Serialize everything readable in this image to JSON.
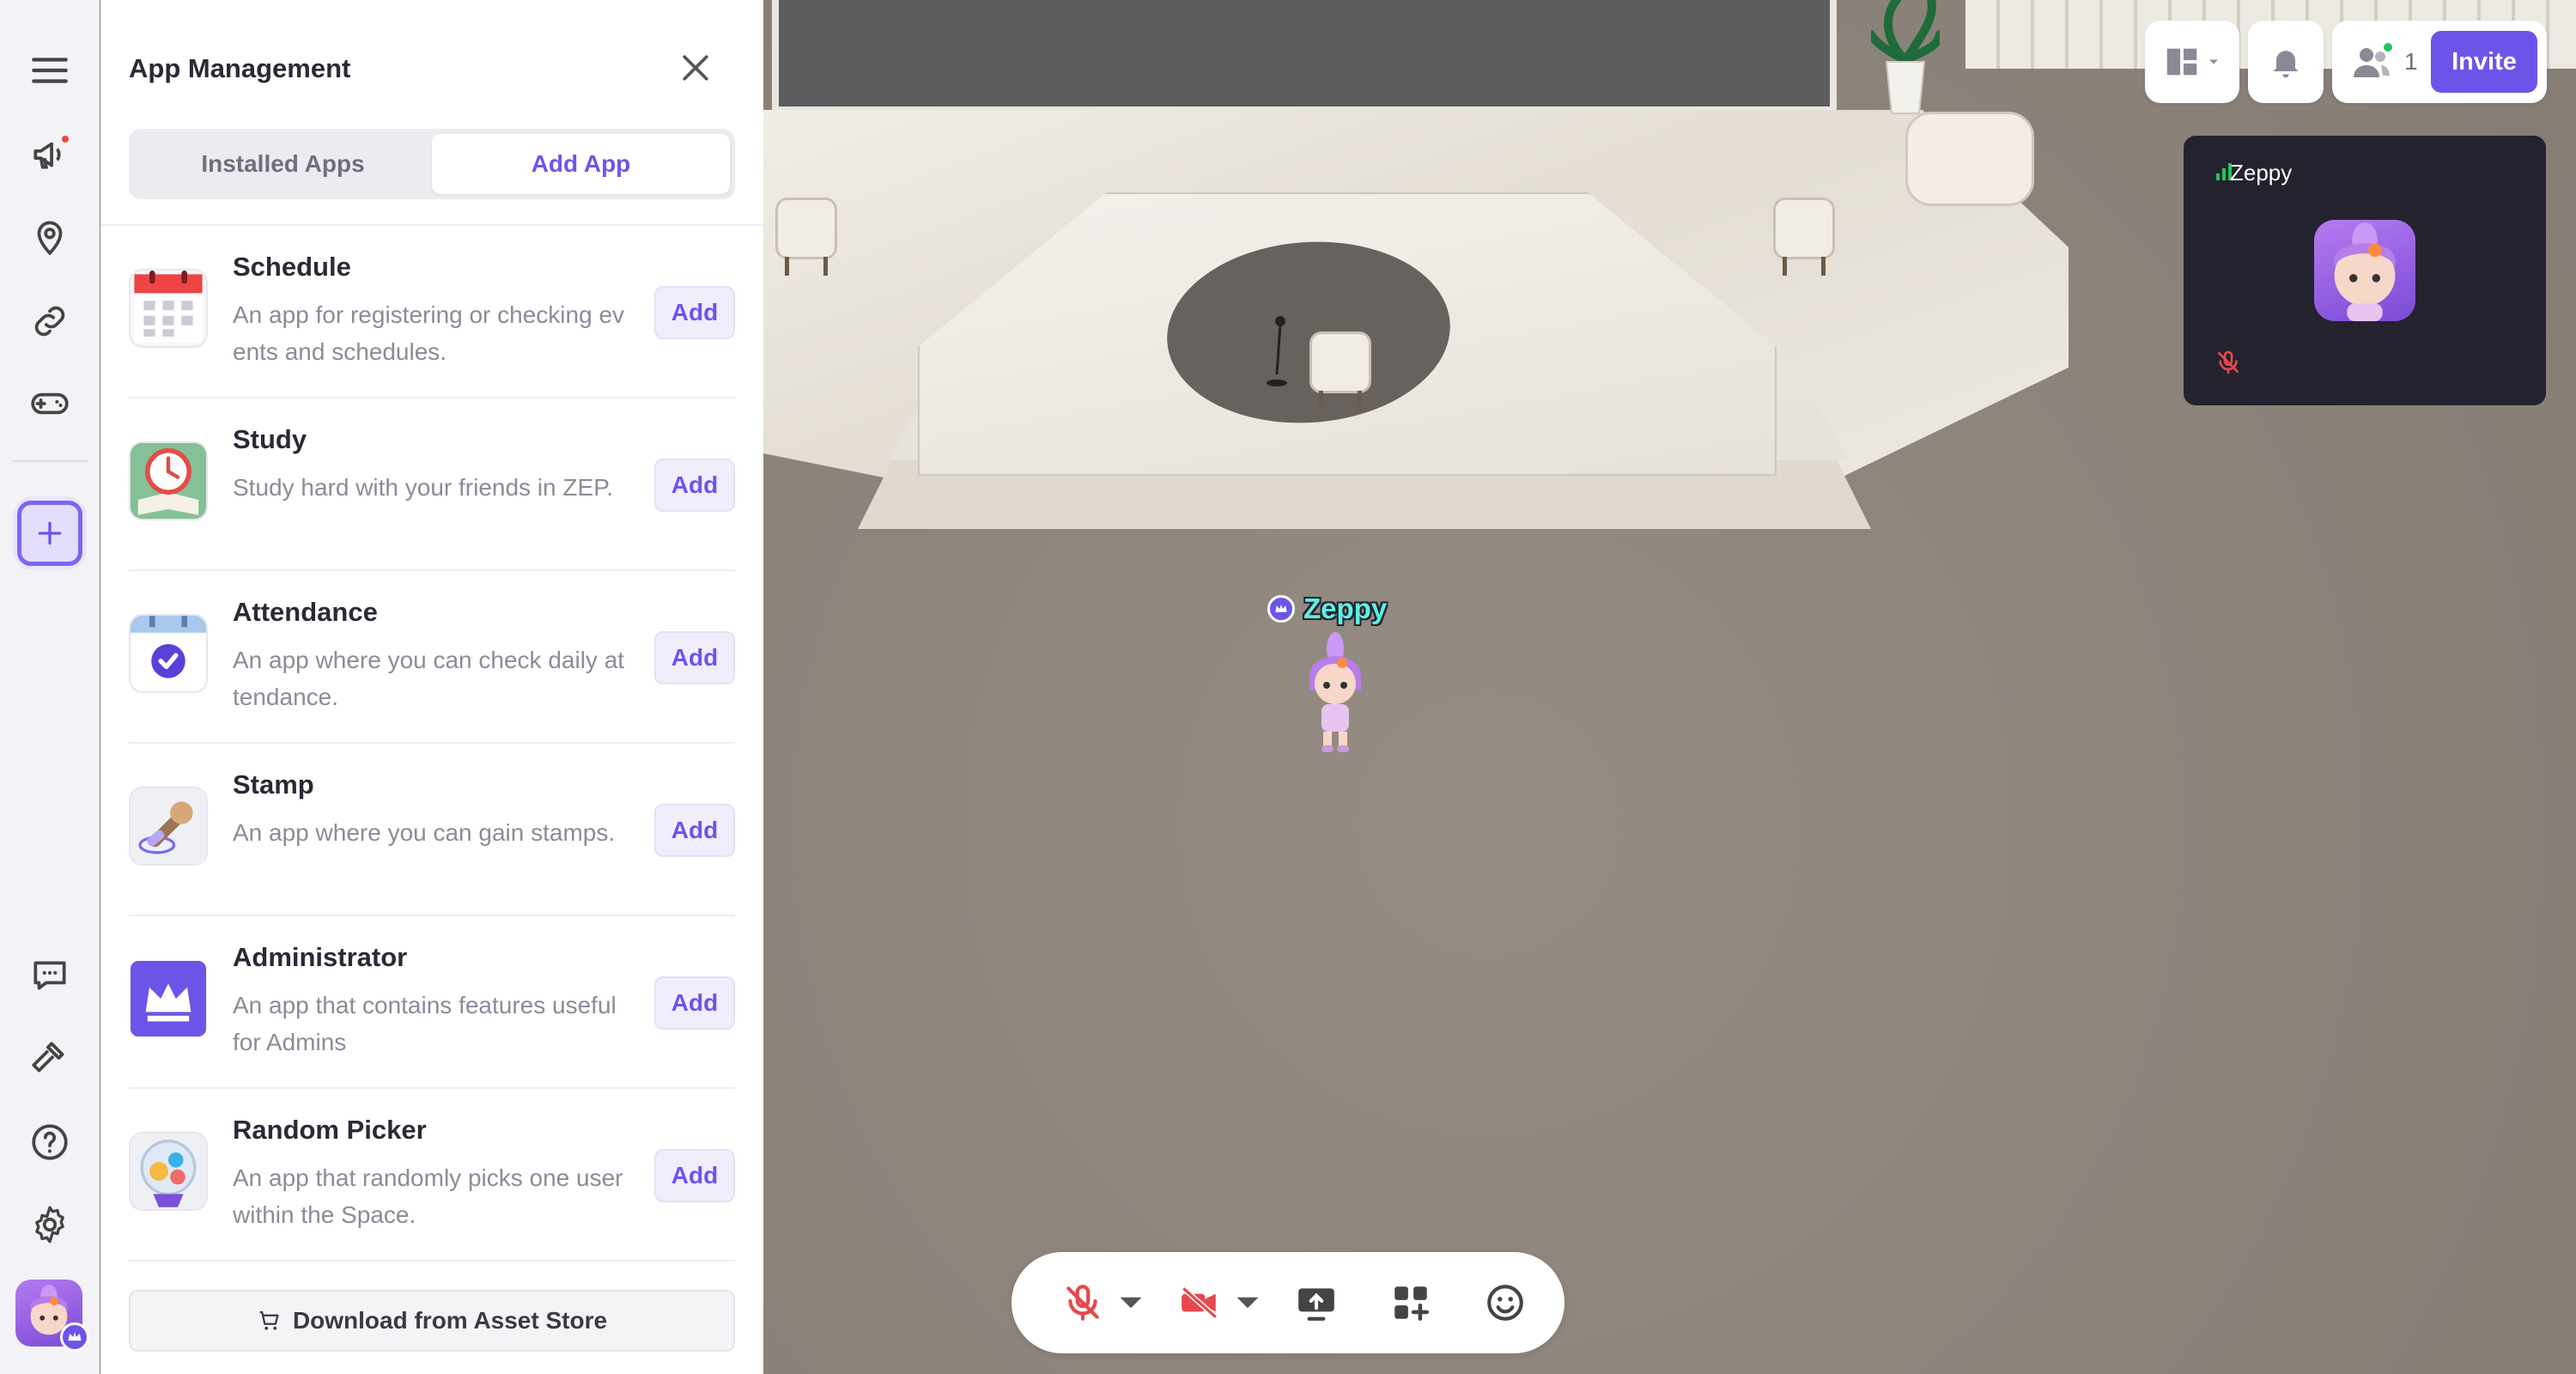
{
  "panel": {
    "title": "App Management",
    "tabs": [
      {
        "label": "Installed Apps",
        "active": false
      },
      {
        "label": "Add App",
        "active": true
      }
    ],
    "add_label": "Add",
    "apps": [
      {
        "name": "Schedule",
        "description": "An app for registering or checking events and schedules.",
        "icon": "calendar-icon"
      },
      {
        "name": "Study",
        "description": "Study hard with your friends in ZEP.",
        "icon": "study-clock-icon"
      },
      {
        "name": "Attendance",
        "description": "An app where you can check daily attendance.",
        "icon": "attendance-check-icon"
      },
      {
        "name": "Stamp",
        "description": "An app where you can gain stamps.",
        "icon": "stamp-icon"
      },
      {
        "name": "Administrator",
        "description": "An app that contains features useful for Admins",
        "icon": "crown-icon"
      },
      {
        "name": "Random Picker",
        "description": "An app that randomly picks one user within the Space.",
        "icon": "gacha-icon"
      }
    ],
    "store_label": "Download from Asset Store"
  },
  "header": {
    "participant_count": "1",
    "invite_label": "Invite"
  },
  "video": {
    "name": "Zeppy"
  },
  "player": {
    "name": "Zeppy"
  },
  "colors": {
    "accent": "#6b55e9",
    "name_tag": "#5ef0e0",
    "muted_red": "#e5484d",
    "online_green": "#22c55e"
  }
}
